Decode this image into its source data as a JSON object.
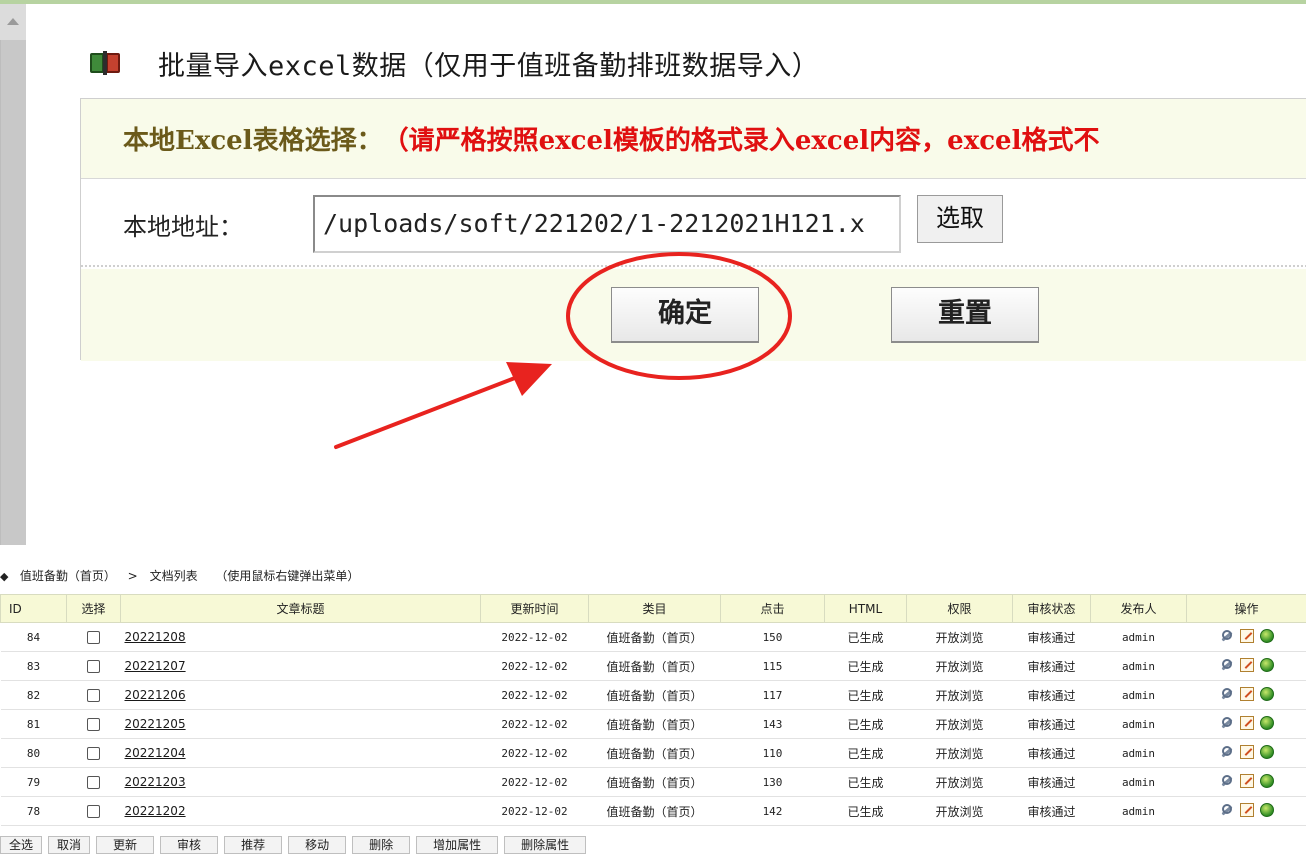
{
  "import_panel": {
    "title": "批量导入excel数据（仅用于值班备勤排班数据导入）",
    "hint_label": "本地Excel表格选择：",
    "hint_warning": "（请严格按照excel模板的格式录入excel内容，excel格式不",
    "path_label": "本地地址：",
    "path_value": "/uploads/soft/221202/1-2212021H121.x",
    "choose_button": "选取",
    "confirm_button": "确定",
    "reset_button": "重置"
  },
  "annotation": {
    "highlight_color": "#e8231f"
  },
  "list": {
    "breadcrumb_category": "值班备勤（首页）",
    "breadcrumb_separator": ">",
    "breadcrumb_page": "文档列表",
    "breadcrumb_hint": "（使用鼠标右键弹出菜单）",
    "columns": [
      "ID",
      "选择",
      "文章标题",
      "更新时间",
      "类目",
      "点击",
      "HTML",
      "权限",
      "审核状态",
      "发布人",
      "操作"
    ],
    "rows": [
      {
        "id": "84",
        "title": "20221208",
        "date": "2022-12-02",
        "category": "值班备勤（首页）",
        "clicks": "150",
        "html": "已生成",
        "permission": "开放浏览",
        "status": "审核通过",
        "publisher": "admin"
      },
      {
        "id": "83",
        "title": "20221207",
        "date": "2022-12-02",
        "category": "值班备勤（首页）",
        "clicks": "115",
        "html": "已生成",
        "permission": "开放浏览",
        "status": "审核通过",
        "publisher": "admin"
      },
      {
        "id": "82",
        "title": "20221206",
        "date": "2022-12-02",
        "category": "值班备勤（首页）",
        "clicks": "117",
        "html": "已生成",
        "permission": "开放浏览",
        "status": "审核通过",
        "publisher": "admin"
      },
      {
        "id": "81",
        "title": "20221205",
        "date": "2022-12-02",
        "category": "值班备勤（首页）",
        "clicks": "143",
        "html": "已生成",
        "permission": "开放浏览",
        "status": "审核通过",
        "publisher": "admin"
      },
      {
        "id": "80",
        "title": "20221204",
        "date": "2022-12-02",
        "category": "值班备勤（首页）",
        "clicks": "110",
        "html": "已生成",
        "permission": "开放浏览",
        "status": "审核通过",
        "publisher": "admin"
      },
      {
        "id": "79",
        "title": "20221203",
        "date": "2022-12-02",
        "category": "值班备勤（首页）",
        "clicks": "130",
        "html": "已生成",
        "permission": "开放浏览",
        "status": "审核通过",
        "publisher": "admin"
      },
      {
        "id": "78",
        "title": "20221202",
        "date": "2022-12-02",
        "category": "值班备勤（首页）",
        "clicks": "142",
        "html": "已生成",
        "permission": "开放浏览",
        "status": "审核通过",
        "publisher": "admin"
      }
    ],
    "actions": [
      "全选",
      "取消",
      "更新",
      "审核",
      "推荐",
      "移动",
      "删除",
      "增加属性",
      "删除属性"
    ]
  }
}
